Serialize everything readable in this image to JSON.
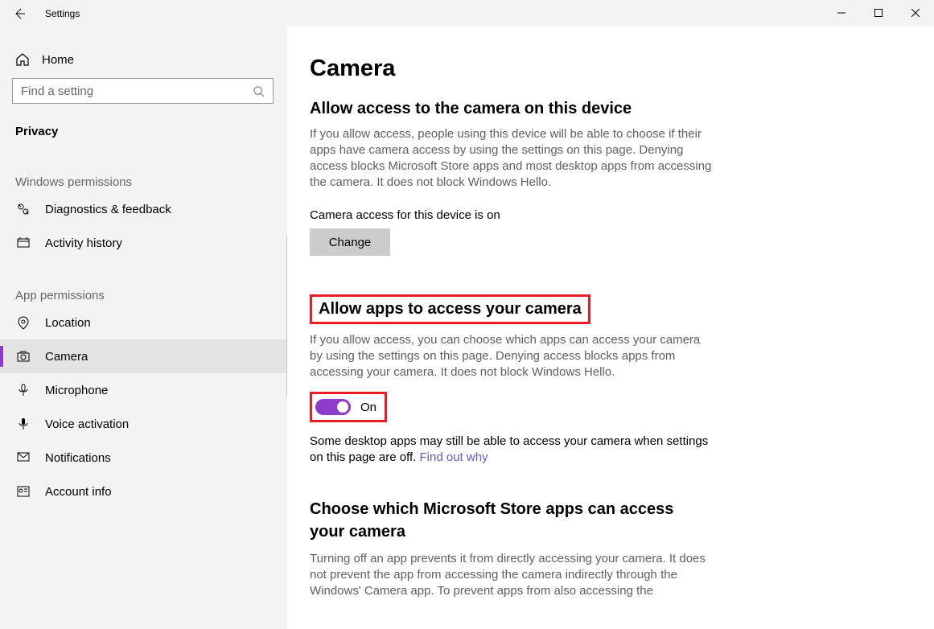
{
  "app_title": "Settings",
  "search": {
    "placeholder": "Find a setting"
  },
  "home_label": "Home",
  "category_label": "Privacy",
  "section_windows": "Windows permissions",
  "nav_windows": [
    {
      "label": "Diagnostics & feedback"
    },
    {
      "label": "Activity history"
    }
  ],
  "section_app": "App permissions",
  "nav_app": [
    {
      "label": "Location"
    },
    {
      "label": "Camera"
    },
    {
      "label": "Microphone"
    },
    {
      "label": "Voice activation"
    },
    {
      "label": "Notifications"
    },
    {
      "label": "Account info"
    }
  ],
  "page": {
    "title": "Camera",
    "s1_title": "Allow access to the camera on this device",
    "s1_desc": "If you allow access, people using this device will be able to choose if their apps have camera access by using the settings on this page. Denying access blocks Microsoft Store apps and most desktop apps from accessing the camera. It does not block Windows Hello.",
    "s1_status": "Camera access for this device is on",
    "change_btn": "Change",
    "s2_title": "Allow apps to access your camera",
    "s2_desc": "If you allow access, you can choose which apps can access your camera by using the settings on this page. Denying access blocks apps from accessing your camera. It does not block Windows Hello.",
    "toggle_label": "On",
    "s2_note_a": "Some desktop apps may still be able to access your camera when settings on this page are off. ",
    "s2_note_link": "Find out why",
    "s3_title": "Choose which Microsoft Store apps can access your camera",
    "s3_desc": "Turning off an app prevents it from directly accessing your camera. It does not prevent the app from accessing the camera indirectly through the Windows' Camera app. To prevent apps from also accessing the"
  }
}
